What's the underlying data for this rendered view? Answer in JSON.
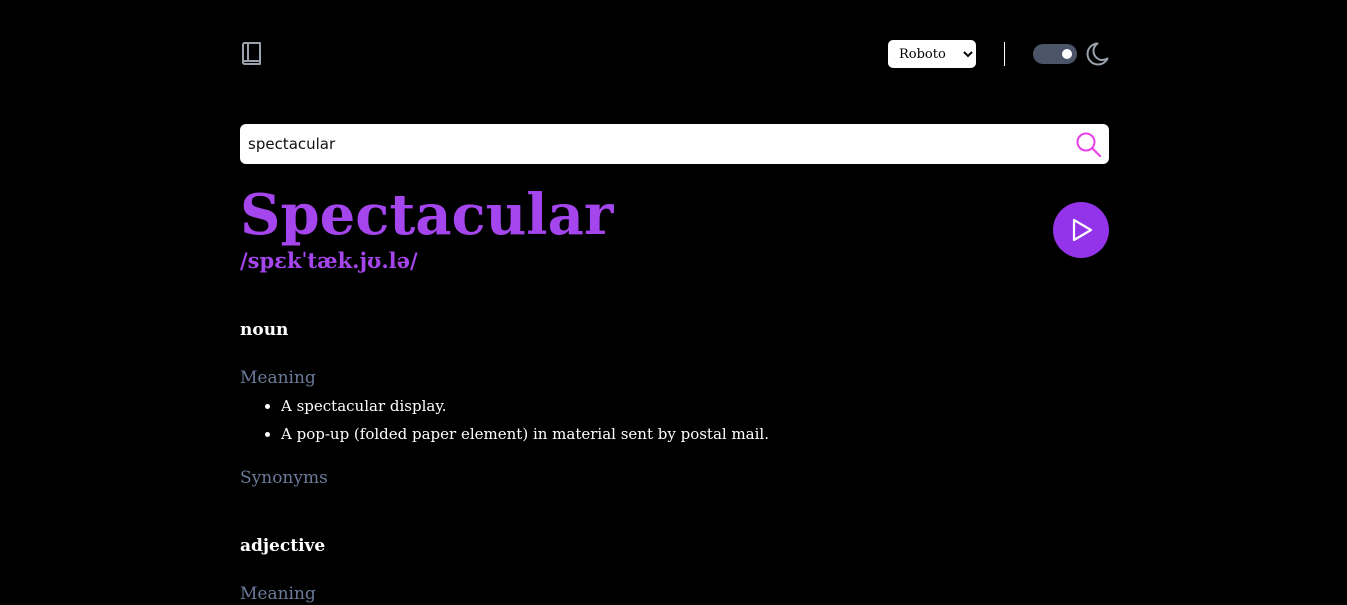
{
  "header": {
    "logo_icon": "book-icon",
    "font_select": {
      "selected": "Roboto",
      "options": [
        "Roboto"
      ]
    },
    "theme_toggle": {
      "state": "on"
    },
    "moon_icon": "moon-icon"
  },
  "search": {
    "value": "spectacular",
    "icon": "search-icon"
  },
  "entry": {
    "word": "Spectacular",
    "phonetic": "/spɛkˈtæk.jʊ.lə/",
    "play_icon": "play-icon",
    "meanings": [
      {
        "part_of_speech": "noun",
        "meaning_label": "Meaning",
        "definitions": [
          "A spectacular display.",
          "A pop-up (folded paper element) in material sent by postal mail."
        ],
        "synonyms_label": "Synonyms"
      },
      {
        "part_of_speech": "adjective",
        "meaning_label": "Meaning"
      }
    ]
  },
  "colors": {
    "background": "#000000",
    "accent": "#a445ed",
    "play_button": "#9333ea",
    "label": "#6b7a99",
    "search_icon": "#e83ee8",
    "toggle_track": "#4b5567"
  }
}
